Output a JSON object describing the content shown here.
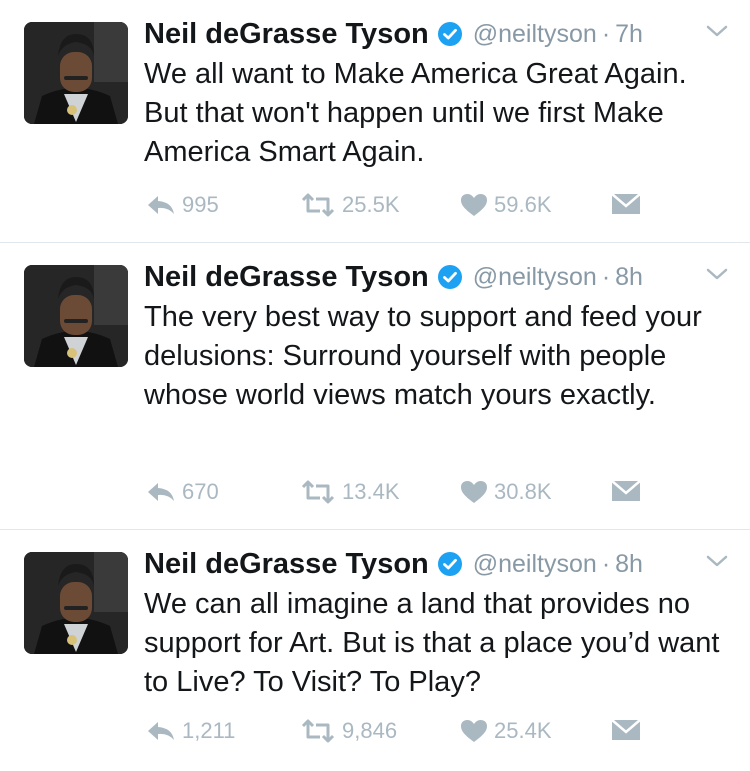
{
  "tweets": [
    {
      "author_name": "Neil deGrasse Tyson",
      "handle": "@neiltyson",
      "separator": "·",
      "time": "7h",
      "text": "We all want to Make America Great Again. But that won't happen until we first Make America Smart Again.",
      "replies": "995",
      "retweets": "25.5K",
      "likes": "59.6K"
    },
    {
      "author_name": "Neil deGrasse Tyson",
      "handle": "@neiltyson",
      "separator": "·",
      "time": "8h",
      "text": "The very best way to support and feed your delusions: Surround yourself with people whose world views match yours exactly.",
      "replies": "670",
      "retweets": "13.4K",
      "likes": "30.8K"
    },
    {
      "author_name": "Neil deGrasse Tyson",
      "handle": "@neiltyson",
      "separator": "·",
      "time": "8h",
      "text": "We can all imagine a land that provides no support for Art. But is that a place you’d want to Live? To Visit? To Play?",
      "replies": "1,211",
      "retweets": "9,846",
      "likes": "25.4K"
    }
  ],
  "icons": {
    "verified": "verified-badge-icon",
    "caret": "chevron-down-icon",
    "reply": "reply-arrow-icon",
    "retweet": "retweet-icon",
    "like": "heart-icon",
    "dm": "envelope-icon"
  },
  "colors": {
    "text": "#14171a",
    "secondary": "#8899a6",
    "action": "#aab8c2",
    "verified": "#1da1f2",
    "divider": "#e1e8ed"
  }
}
